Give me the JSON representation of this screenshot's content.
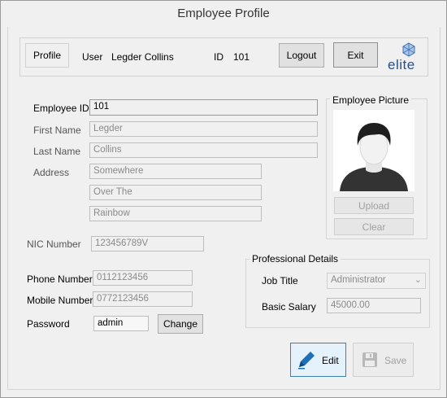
{
  "window": {
    "title": "Employee Profile"
  },
  "topbar": {
    "profile_label": "Profile",
    "user_label": "User",
    "user_name": "Legder Collins",
    "id_label": "ID",
    "id_value": "101",
    "logout_label": "Logout",
    "exit_label": "Exit",
    "logo_text": "elite"
  },
  "form": {
    "employee_id": {
      "label": "Employee ID",
      "value": "101"
    },
    "first_name": {
      "label": "First Name",
      "value": "Legder"
    },
    "last_name": {
      "label": "Last Name",
      "value": "Collins"
    },
    "address": {
      "label": "Address",
      "line1": "Somewhere",
      "line2": "Over The",
      "line3": "Rainbow"
    },
    "nic": {
      "label": "NIC Number",
      "value": "123456789V"
    },
    "phone": {
      "label": "Phone Number",
      "value": "0112123456"
    },
    "mobile": {
      "label": "Mobile Number",
      "value": "0772123456"
    },
    "password": {
      "label": "Password",
      "value": "admin",
      "change_label": "Change"
    }
  },
  "picture": {
    "title": "Employee Picture",
    "upload_label": "Upload",
    "clear_label": "Clear"
  },
  "professional": {
    "title": "Professional Details",
    "job_title_label": "Job Title",
    "job_title_value": "Administrator",
    "salary_label": "Basic Salary",
    "salary_value": "45000.00"
  },
  "actions": {
    "edit_label": "Edit",
    "save_label": "Save"
  },
  "colors": {
    "accent": "#3c7fb1",
    "edit_icon": "#1f6fb5"
  }
}
